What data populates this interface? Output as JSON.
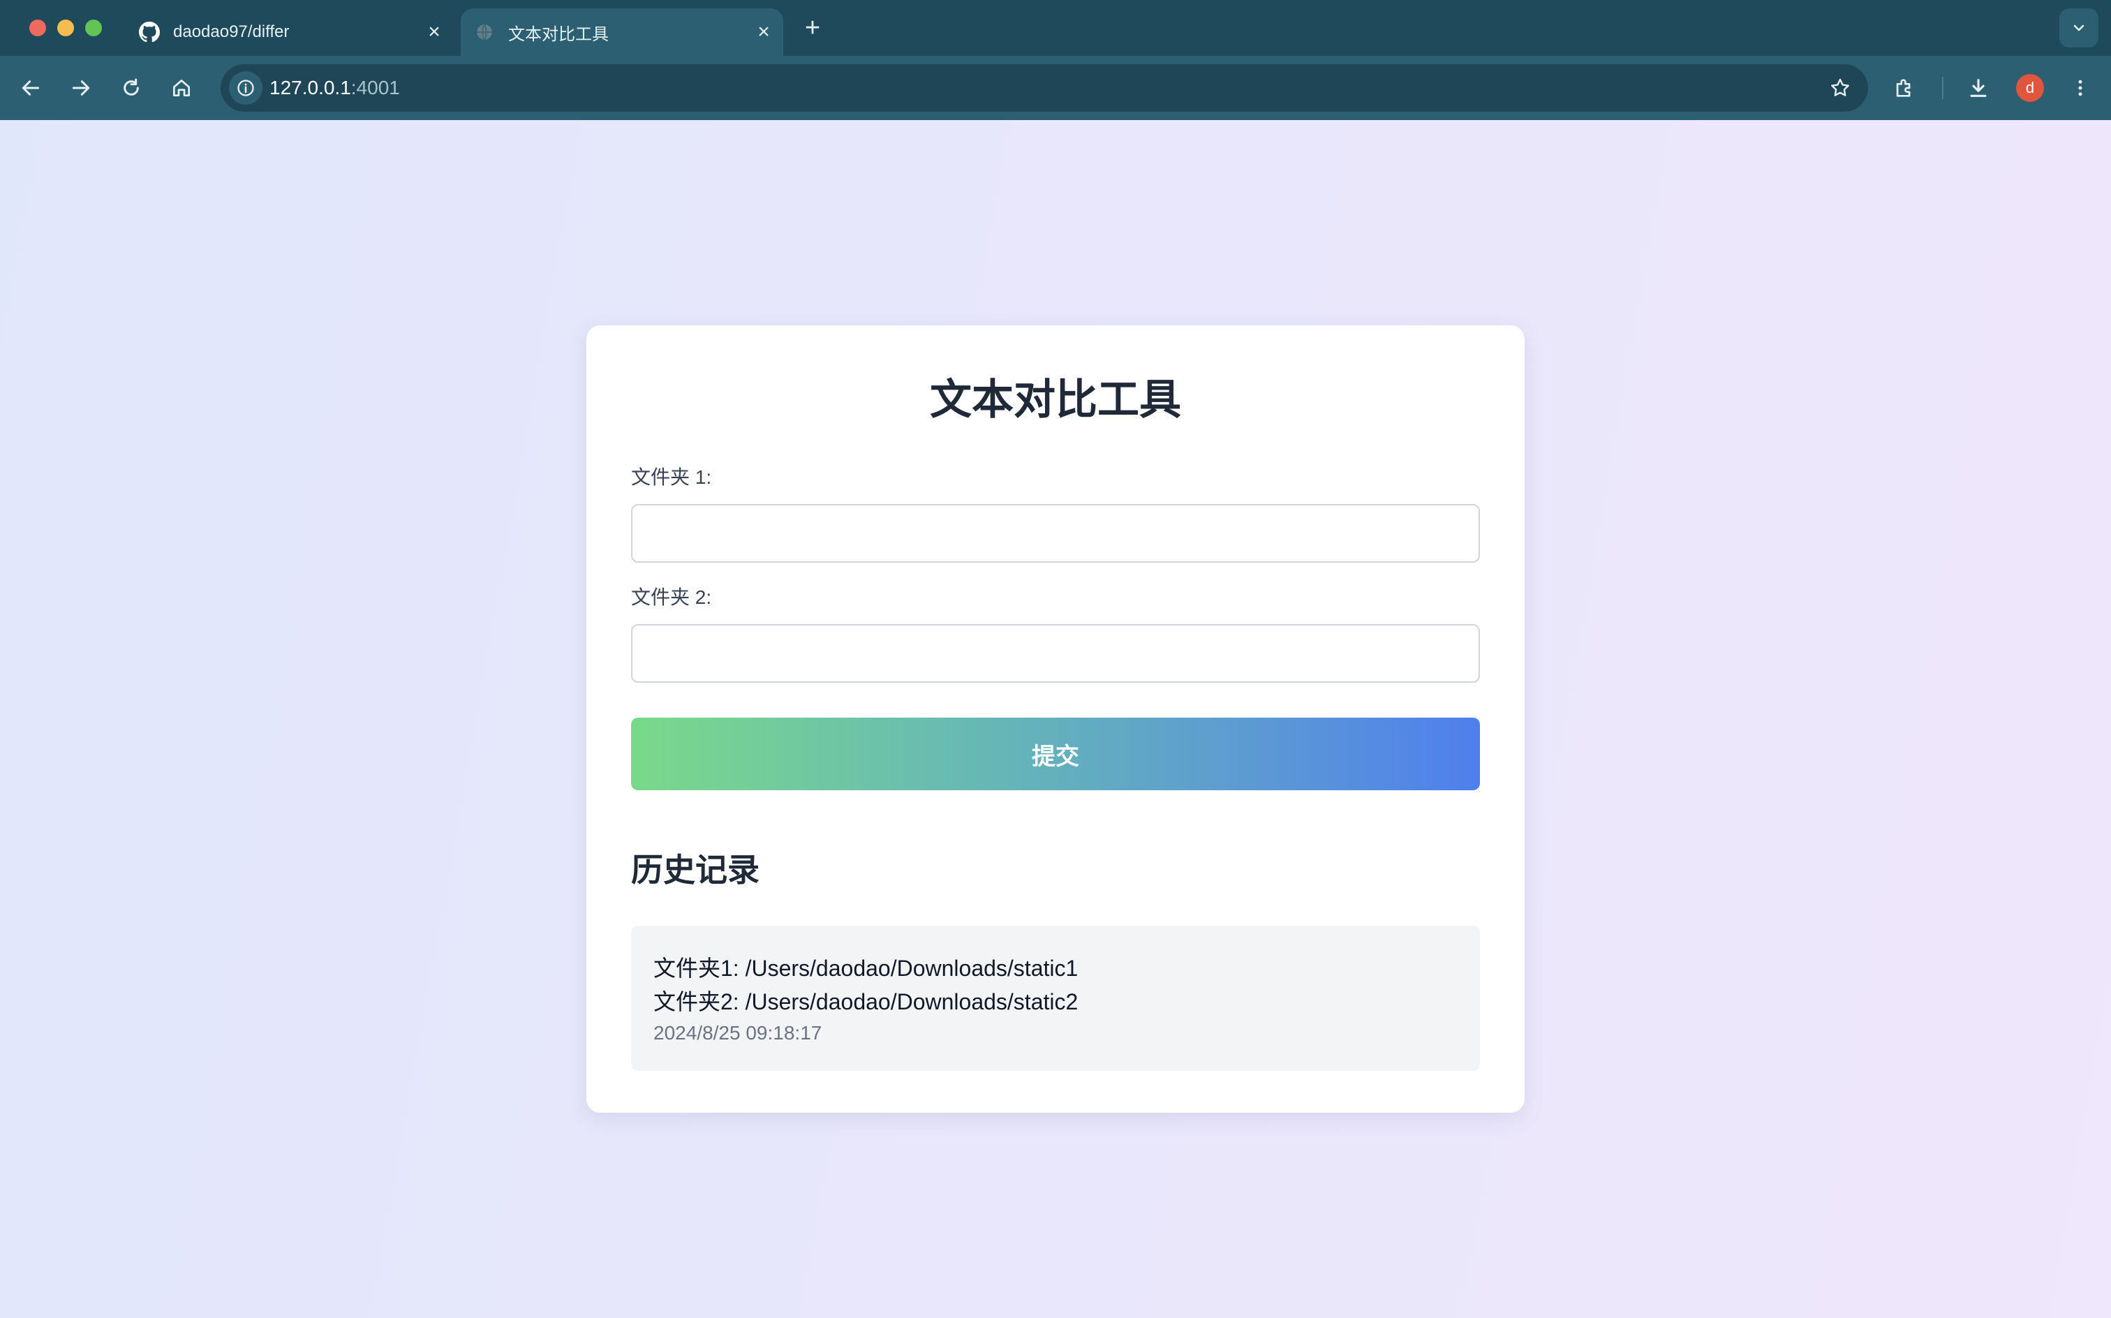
{
  "browser": {
    "tabs": [
      {
        "title": "daodao97/differ",
        "icon": "github-icon",
        "active": false
      },
      {
        "title": "文本对比工具",
        "icon": "globe-icon",
        "active": true
      }
    ],
    "address": {
      "host": "127.0.0.1",
      "port": ":4001"
    },
    "profile_initial": "d",
    "colors": {
      "chrome": "#1f4a5b",
      "toolbar": "#2c5f72",
      "avatar": "#e0553c"
    }
  },
  "page": {
    "title": "文本对比工具",
    "folder1_label": "文件夹 1:",
    "folder1_value": "",
    "folder2_label": "文件夹 2:",
    "folder2_value": "",
    "submit_label": "提交",
    "history_title": "历史记录",
    "history": [
      {
        "folder1": "文件夹1: /Users/daodao/Downloads/static1",
        "folder2": "文件夹2: /Users/daodao/Downloads/static2",
        "time": "2024/8/25 09:18:17"
      }
    ],
    "colors": {
      "gradient_start": "#79d98a",
      "gradient_end": "#4f7fed"
    }
  }
}
